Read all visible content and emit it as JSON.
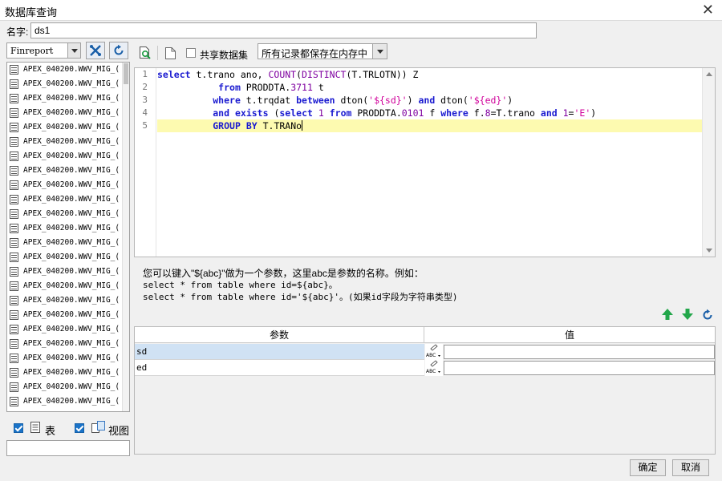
{
  "window": {
    "title": "数据库查询",
    "close_glyph": "✕"
  },
  "name_field": {
    "label": "名字:",
    "value": "ds1"
  },
  "datasource": {
    "selected": "Finreport"
  },
  "tables": [
    "APEX_040200.WWV_MIG_(",
    "APEX_040200.WWV_MIG_(",
    "APEX_040200.WWV_MIG_(",
    "APEX_040200.WWV_MIG_(",
    "APEX_040200.WWV_MIG_(",
    "APEX_040200.WWV_MIG_(",
    "APEX_040200.WWV_MIG_(",
    "APEX_040200.WWV_MIG_(",
    "APEX_040200.WWV_MIG_(",
    "APEX_040200.WWV_MIG_(",
    "APEX_040200.WWV_MIG_(",
    "APEX_040200.WWV_MIG_(",
    "APEX_040200.WWV_MIG_(",
    "APEX_040200.WWV_MIG_(",
    "APEX_040200.WWV_MIG_(",
    "APEX_040200.WWV_MIG_(",
    "APEX_040200.WWV_MIG_(",
    "APEX_040200.WWV_MIG_(",
    "APEX_040200.WWV_MIG_(",
    "APEX_040200.WWV_MIG_(",
    "APEX_040200.WWV_MIG_(",
    "APEX_040200.WWV_MIG_(",
    "APEX_040200.WWV_MIG_(",
    "APEX_040200.WWV_MIG_("
  ],
  "filters": {
    "table_label": "表",
    "view_label": "视图"
  },
  "toolbar": {
    "share_label": "共享数据集",
    "storage_mode": "所有记录都保存在内存中"
  },
  "editor": {
    "line_numbers": [
      "1",
      "2",
      "3",
      "4",
      "5"
    ],
    "lines": [
      "select t.trano ano, COUNT(DISTINCT(T.TRLOTN)) Z",
      "           from PRODDTA.f3711 t",
      "          where t.trqdat between dton('${sd}') and dton('${ed}')",
      "          and exists (select 1 from PRODDTA.f0101 f where f.aban8=T.trano and abat1='E')",
      "          GROUP BY T.TRANo"
    ]
  },
  "help": {
    "line1": "您可以键入\"${abc}\"做为一个参数，这里abc是参数的名称。例如：",
    "line2": "select * from table where id=${abc}。",
    "line3": "select * from table where id='${abc}'。(如果id字段为字符串类型)"
  },
  "params": {
    "header_name": "参数",
    "header_value": "值",
    "rows": [
      {
        "name": "sd",
        "value": ""
      },
      {
        "name": "ed",
        "value": ""
      }
    ],
    "type_badge": "ABC"
  },
  "buttons": {
    "ok": "确定",
    "cancel": "取消"
  },
  "colors": {
    "accent": "#1a73c8",
    "highlight_line": "#fdfab0",
    "selected_row": "#d0e2f4"
  }
}
